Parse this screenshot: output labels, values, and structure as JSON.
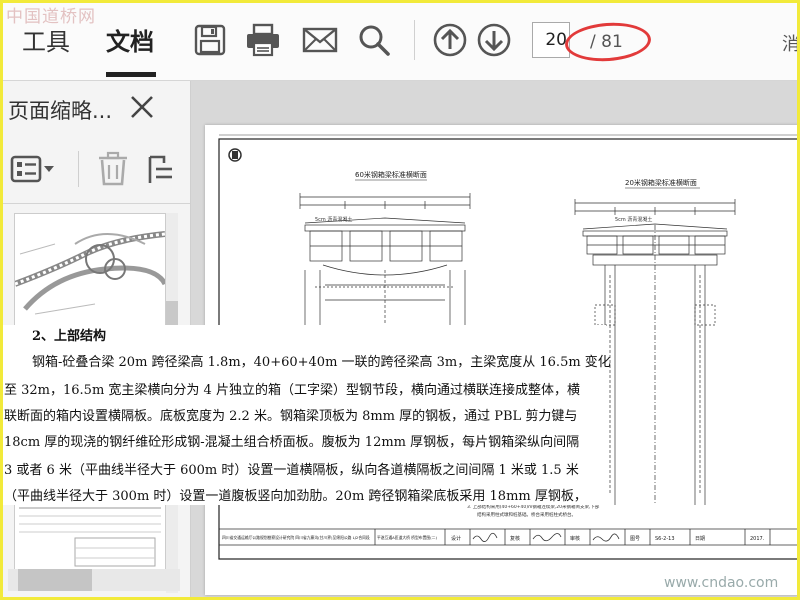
{
  "watermark_top": "中国道桥网",
  "watermark_bottom": "www.cndao.com",
  "toolbar": {
    "tabs": [
      {
        "label": "工具"
      },
      {
        "label": "文档"
      }
    ],
    "page_number": "20",
    "page_total": "/ 81",
    "edge_glyph": "消"
  },
  "sidebar": {
    "title": "页面缩略..."
  },
  "drawing": {
    "left_title": "60米钢箱梁标准横断面",
    "right_title": "20米钢箱梁标准横断面",
    "note_line1": "3. 上部结构采用(40+60+40)m钢箱连续梁,20米钢箱简支梁,下部",
    "note_line2": "结构采用柱式墩和桩基础。桥台采用桩柱式桥台。",
    "titleblock": {
      "company": "四川省交通运输厅公路规划勘察设计研究院 四川省九寨沟(甘川界)至绵阳公路 LJ2合同段",
      "drawing_name": "平遂互通A匝道大桥 桥型布置图(二)",
      "label_design": "设计",
      "label_review": "复核",
      "label_approve": "审核",
      "label_drawing_no": "图号",
      "drawing_no": "S6-2-13",
      "label_date": "日期",
      "date": "2017."
    }
  },
  "overlay": {
    "heading": "2、上部结构",
    "lines": [
      "钢箱-砼叠合梁 20m 跨径梁高 1.8m，40+60+40m 一联的跨径梁高 3m，主梁宽度从 16.5m 变化",
      "至 32m，16.5m 宽主梁横向分为 4 片独立的箱（工字梁）型钢节段，横向通过横联连接成整体，横",
      "联断面的箱内设置横隔板。底板宽度为 2.2 米。钢箱梁顶板为 8mm 厚的钢板，通过 PBL 剪力键与",
      "18cm 厚的现浇的钢纤维砼形成钢-混凝土组合桥面板。腹板为 12mm 厚钢板，每片钢箱梁纵向间隔",
      "3 或者 6 米（平曲线半径大于 600m 时）设置一道横隔板，纵向各道横隔板之间间隔 1 米或 1.5 米",
      "（平曲线半径大于 300m 时）设置一道腹板竖向加劲肋。20m 跨径钢箱梁底板采用 18mm 厚钢板，"
    ]
  },
  "colors": {
    "frame": "#f2ea3a",
    "annotation_ellipse": "#e23a3a",
    "watermark": "#e3c2c2"
  }
}
